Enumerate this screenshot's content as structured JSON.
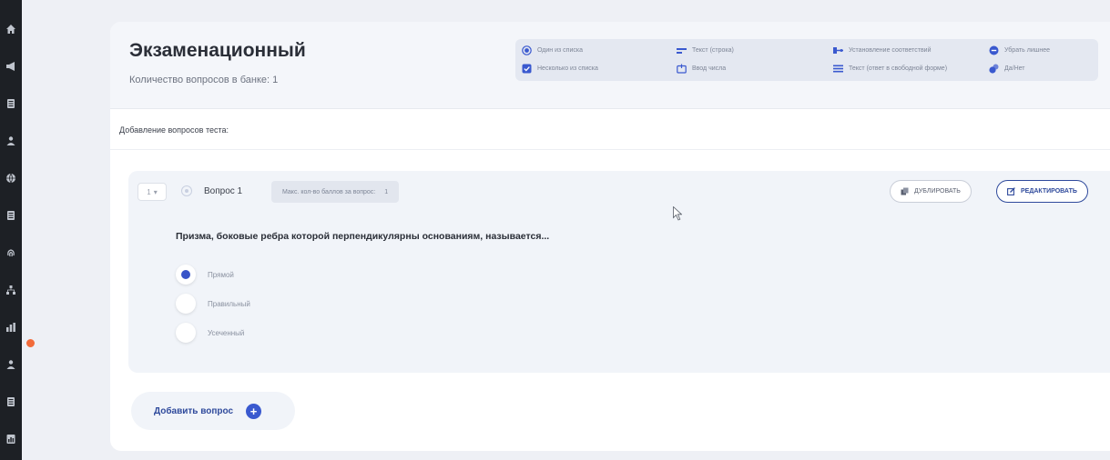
{
  "sidebar": {
    "icons": [
      "home-icon",
      "megaphone-icon",
      "document-icon",
      "person-icon",
      "globe-icon",
      "document-icon",
      "fingerprint-icon",
      "org-chart-icon",
      "chart-icon",
      "person-icon",
      "document-icon",
      "chart-doc-icon"
    ],
    "notification_color": "#f26b3a"
  },
  "bank": {
    "title": "Экзаменационный",
    "question_count": "Количество вопросов в банке: 1"
  },
  "question_types": [
    {
      "label": "Один из списка",
      "icon": "radio-icon"
    },
    {
      "label": "Несколько из списка",
      "icon": "checkbox-icon"
    },
    {
      "label": "Текст (строка)",
      "icon": "text-line-icon"
    },
    {
      "label": "Ввод числа",
      "icon": "number-input-icon"
    },
    {
      "label": "Установление соответствий",
      "icon": "match-icon"
    },
    {
      "label": "Текст (ответ в свободной форме)",
      "icon": "text-block-icon"
    },
    {
      "label": "Убрать лишнее",
      "icon": "remove-icon"
    },
    {
      "label": "Да/Нет",
      "icon": "yes-no-icon"
    }
  ],
  "section": {
    "label": "Добавление вопросов теста:"
  },
  "question": {
    "stepper": "1",
    "name": "Вопрос 1",
    "points_label": "Макс. кол-во баллов за вопрос:",
    "points_value": "1",
    "duplicate_label": "ДУБЛИРОВАТЬ",
    "edit_label": "РЕДАКТИРОВАТЬ",
    "text": "Призма, боковые ребра которой перпендикулярны основаниям, называется...",
    "options": [
      {
        "label": "Прямой",
        "selected": true
      },
      {
        "label": "Правильный",
        "selected": false
      },
      {
        "label": "Усеченный",
        "selected": false
      }
    ]
  },
  "add_question": {
    "label": "Добавить вопрос"
  },
  "colors": {
    "accent": "#3a59cf",
    "edit": "#2f4a9c",
    "sidebar": "#1d2025"
  }
}
